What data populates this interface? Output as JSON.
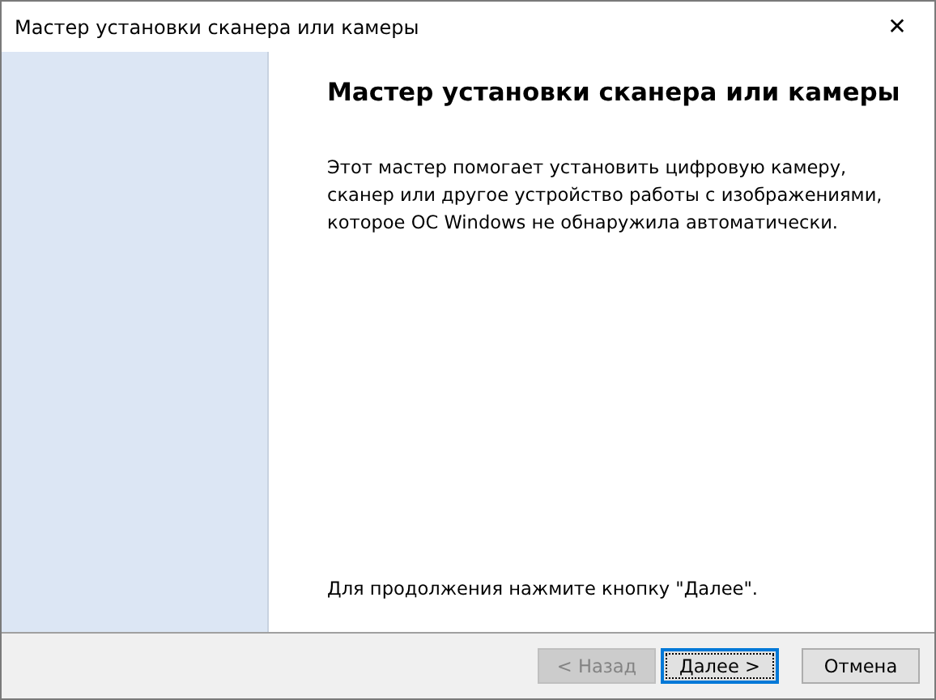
{
  "window": {
    "title": "Мастер установки сканера или камеры",
    "close": "✕"
  },
  "heading": "Мастер установки сканера или камеры",
  "description": [
    "Этот мастер помогает установить цифровую камеру,",
    "сканер или другое устройство работы с изображениями,",
    "которое ОС Windows не обнаружила автоматически."
  ],
  "hint": "Для продолжения нажмите кнопку \"Далее\".",
  "buttons": [
    {
      "label": "< Назад",
      "disabled": true,
      "focused": false
    },
    {
      "label": "Далее >",
      "disabled": false,
      "focused": true
    },
    {
      "label": "Отмена",
      "disabled": false,
      "focused": false
    }
  ]
}
